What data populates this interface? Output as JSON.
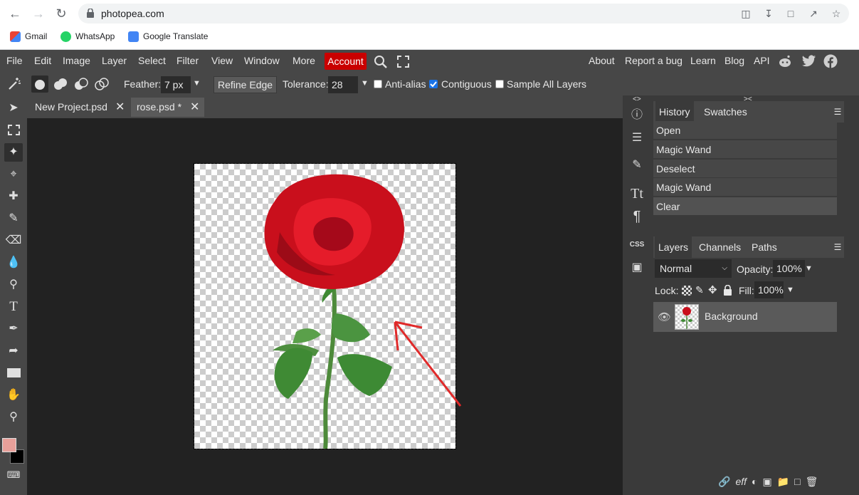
{
  "browser": {
    "url": "photopea.com",
    "bookmarks": [
      "Gmail",
      "WhatsApp",
      "Google Translate"
    ]
  },
  "menubar": {
    "items": [
      "File",
      "Edit",
      "Image",
      "Layer",
      "Select",
      "Filter",
      "View",
      "Window",
      "More"
    ],
    "account_label": "Account",
    "right_links": [
      "About",
      "Report a bug",
      "Learn",
      "Blog",
      "API"
    ]
  },
  "options": {
    "feather_label": "Feather:",
    "feather_value": "7 px",
    "refine_edge": "Refine Edge",
    "tolerance_label": "Tolerance:",
    "tolerance_value": "28",
    "antialias_label": "Anti-alias",
    "antialias_checked": false,
    "contiguous_label": "Contiguous",
    "contiguous_checked": true,
    "sample_all_label": "Sample All Layers",
    "sample_all_checked": false
  },
  "documents": {
    "tabs": [
      {
        "label": "New Project.psd"
      },
      {
        "label": "rose.psd *"
      }
    ]
  },
  "history_panel": {
    "tabs": [
      "History",
      "Swatches"
    ],
    "items": [
      "Open",
      "Magic Wand",
      "Deselect",
      "Magic Wand",
      "Clear"
    ]
  },
  "layers_panel": {
    "tabs": [
      "Layers",
      "Channels",
      "Paths"
    ],
    "blend_mode": "Normal",
    "opacity_label": "Opacity:",
    "opacity_value": "100%",
    "lock_label": "Lock:",
    "fill_label": "Fill:",
    "fill_value": "100%",
    "layers": [
      {
        "name": "Background"
      }
    ]
  },
  "colors": {
    "foreground": "#e8a09a",
    "background": "#000000",
    "account": "#c90000"
  }
}
